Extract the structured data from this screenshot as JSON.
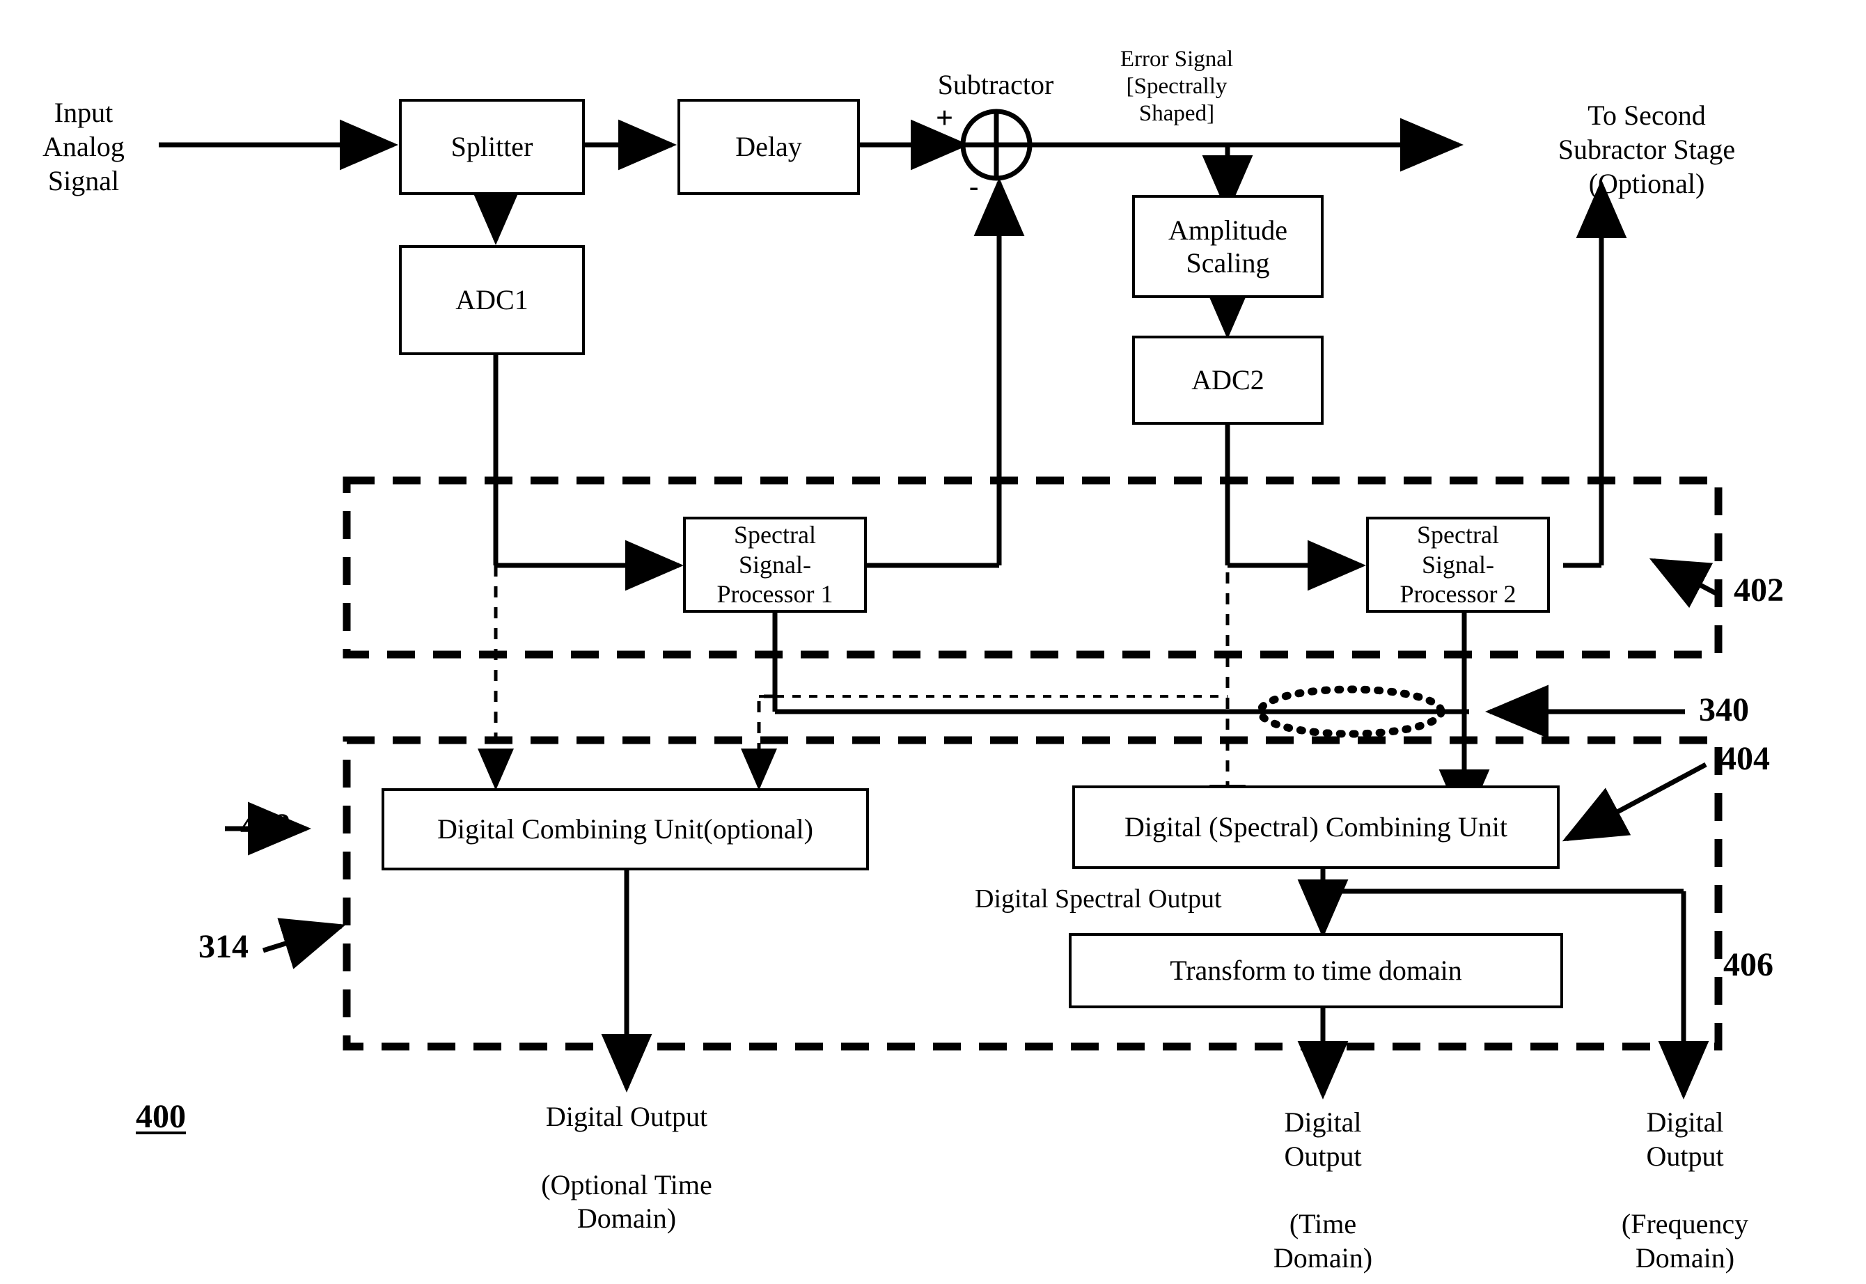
{
  "figure": {
    "number": "400",
    "type": "patent-block-diagram",
    "title_label": "400"
  },
  "blocks": {
    "splitter": "Splitter",
    "delay": "Delay",
    "adc1": "ADC1",
    "adc2": "ADC2",
    "amplitude_scaling": "Amplitude\nScaling",
    "ssp1": "Spectral\nSignal-\nProcessor 1",
    "ssp2": "Spectral\nSignal-\nProcessor 2",
    "digital_combining_optional": "Digital Combining Unit(optional)",
    "digital_spectral_combining": "Digital (Spectral) Combining Unit",
    "transform_time_domain": "Transform to time domain"
  },
  "labels": {
    "input_analog_signal": "Input\nAnalog\nSignal",
    "subtractor": "Subtractor",
    "plus_sign": "+",
    "minus_sign": "-",
    "error_signal": "Error Signal\n[Spectrally\nShaped]",
    "to_second_subtractor": "To Second\nSubractor Stage\n(Optional)",
    "digital_spectral_output": "Digital Spectral Output",
    "output_optional_time": "Digital Output\n\n(Optional Time\nDomain)",
    "output_time": "Digital\nOutput\n\n(Time\nDomain)",
    "output_frequency": "Digital\nOutput\n\n(Frequency\nDomain)"
  },
  "reference_numerals": {
    "n402": "402",
    "n340": "340",
    "n404": "404",
    "n406": "406",
    "n408": "408",
    "n314": "314",
    "n400": "400"
  },
  "colors": {
    "stroke": "#000000",
    "background": "#ffffff"
  }
}
